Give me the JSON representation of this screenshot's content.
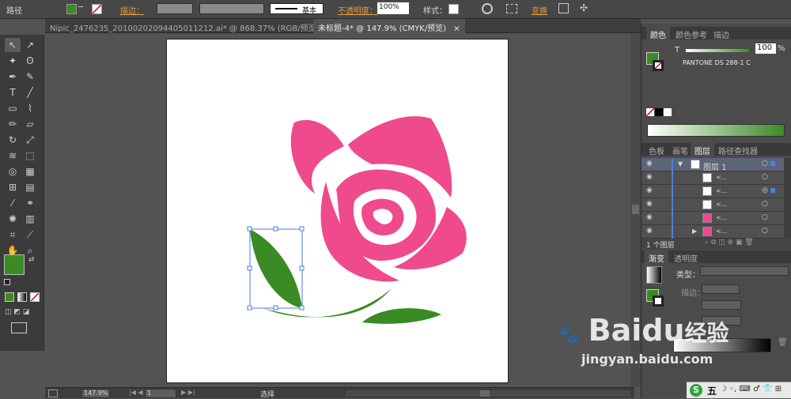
{
  "control_bar": {
    "label": "路径",
    "stroke_label": "描边：",
    "stroke_style": "基本",
    "opacity_label": "不透明度：",
    "opacity_value": "100%",
    "style_label": "样式：",
    "transform_label": "变换",
    "fill_color": "#3a8b23"
  },
  "tabs": [
    {
      "label": "Nipic_2476235_20100202094405011212.ai* @ 868.37% (RGB/预览)",
      "close": "×"
    },
    {
      "label": "未标题-4* @ 147.9% (CMYK/预览)",
      "close": "×"
    }
  ],
  "status": {
    "zoom": "147.9%",
    "page": "1",
    "mode": "选择"
  },
  "color_panel": {
    "tabs": [
      "颜色",
      "颜色参考",
      "描边"
    ],
    "t_label": "T",
    "t_value": "100",
    "percent": "%",
    "pantone": "PANTONE DS 288-1 C"
  },
  "layers_panel": {
    "tabs": [
      "色板",
      "画笔",
      "图层",
      "路径查找器"
    ],
    "layer_name": "图层 1",
    "item_label": "<...",
    "count": "1 个图层"
  },
  "gradient_panel": {
    "tabs": [
      "渐变",
      "透明度"
    ],
    "type_label": "类型：",
    "stroke_label": "描边："
  },
  "watermark": {
    "brand": "Baidu",
    "brand_cn": "经验",
    "url": "jingyan.baidu.com"
  },
  "taskbar": {
    "ime": "五"
  },
  "colors": {
    "rose_pink": "#ee4a8c",
    "leaf_green": "#3a8b23",
    "selection": "#4a7fe0"
  }
}
